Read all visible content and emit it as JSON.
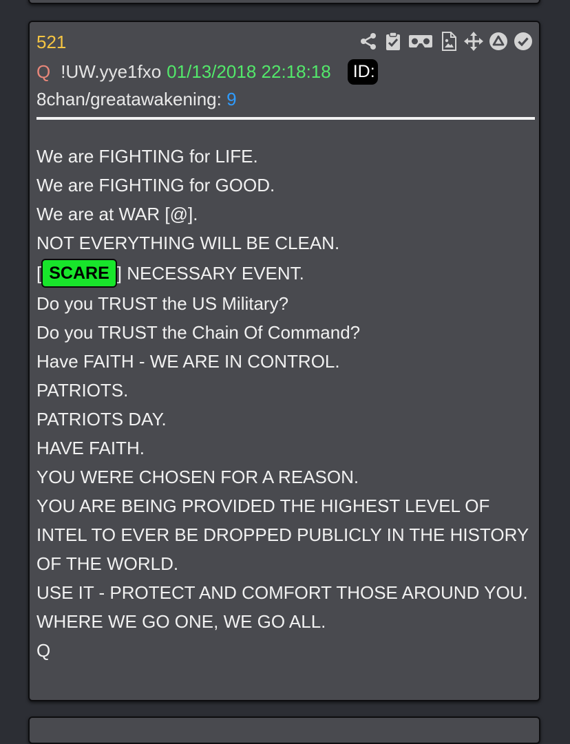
{
  "post": {
    "number": "521",
    "author": "Q",
    "tripcode": "!UW.yye1fxo",
    "timestamp": "01/13/2018 22:18:18",
    "id_label": "ID:",
    "board": "8chan/greatawakening:",
    "post_ref": "9",
    "body": {
      "l1": "We are FIGHTING for LIFE.",
      "l2": "We are FIGHTING for GOOD.",
      "l3": "We are at WAR [@].",
      "l4": "NOT EVERYTHING WILL BE CLEAN.",
      "l5_open": "[",
      "l5_tag": "SCARE",
      "l5_rest": "] NECESSARY EVENT.",
      "l6": "Do you TRUST the US Military?",
      "l7": "Do you TRUST the Chain Of Command?",
      "l8": "Have FAITH - WE ARE IN CONTROL.",
      "l9": "PATRIOTS.",
      "l10": "PATRIOTS DAY.",
      "l11": "HAVE FAITH.",
      "l12": "YOU WERE CHOSEN FOR A REASON.",
      "l13": "YOU ARE BEING PROVIDED THE HIGHEST LEVEL OF INTEL TO EVER BE DROPPED PUBLICLY IN THE HISTORY OF THE WORLD.",
      "l14": "USE IT - PROTECT AND COMFORT THOSE AROUND YOU.",
      "l15": "WHERE WE GO ONE, WE GO ALL.",
      "l16": "Q"
    }
  },
  "toolbar": {
    "icons": [
      "share-icon",
      "clipboard-check-icon",
      "vr-headset-icon",
      "image-file-icon",
      "move-arrows-icon",
      "circle-up-icon",
      "circle-check-icon"
    ]
  },
  "colors": {
    "background": "#2c2e34",
    "card": "#494a4f",
    "post_number": "#f5c543",
    "author": "#e8877a",
    "timestamp": "#53e86b",
    "post_link": "#2f9cff",
    "scare_tag": "#18e52b"
  }
}
